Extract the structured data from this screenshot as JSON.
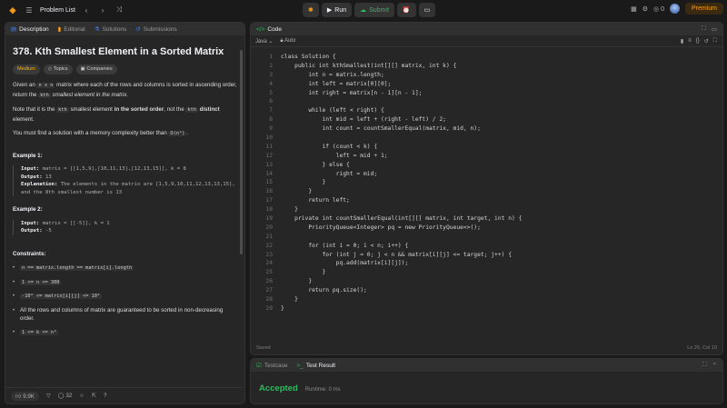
{
  "topbar": {
    "problem_list": "Problem List",
    "run": "Run",
    "submit": "Submit",
    "streak": "0",
    "premium": "Premium"
  },
  "left": {
    "tabs": [
      "Description",
      "Editorial",
      "Solutions",
      "Submissions"
    ],
    "title": "378. Kth Smallest Element in a Sorted Matrix",
    "tags": [
      "Medium",
      "Topics",
      "Companies"
    ],
    "desc1_a": "Given an ",
    "desc1_code1": "n x n",
    "desc1_b": " matrix where each of the rows and columns is sorted in ascending order, return the ",
    "desc1_code2": "kth",
    "desc1_c": " smallest element in the matrix.",
    "desc2_a": "Note that it is the ",
    "desc2_code": "kth",
    "desc2_b": " smallest element ",
    "desc2_bold": "in the sorted order",
    "desc2_c": ", not the ",
    "desc2_code2": "kth",
    "desc2_bold2": " distinct",
    "desc2_d": " element.",
    "desc3_a": "You must find a solution with a memory complexity better than ",
    "desc3_code": "O(n²)",
    "desc3_b": ".",
    "ex1_head": "Example 1:",
    "ex1_input_label": "Input:",
    "ex1_input": " matrix = [[1,5,9],[10,11,13],[12,13,15]], k = 8",
    "ex1_output_label": "Output:",
    "ex1_output": " 13",
    "ex1_expl_label": "Explanation:",
    "ex1_expl": " The elements in the matrix are [1,5,9,10,11,12,13,13,15], and the 8th smallest number is 13",
    "ex2_head": "Example 2:",
    "ex2_input_label": "Input:",
    "ex2_input": " matrix = [[-5]], k = 1",
    "ex2_output_label": "Output:",
    "ex2_output": " -5",
    "cons_head": "Constraints:",
    "cons": [
      "n == matrix.length == matrix[i].length",
      "1 <= n <= 300",
      "-10⁹ <= matrix[i][j] <= 10⁹",
      "All the rows and columns of matrix are guaranteed to be sorted in non-decreasing order.",
      "1 <= k <= n²"
    ],
    "likes": "9.9K",
    "comments": "32"
  },
  "editor": {
    "tab": "Code",
    "lang": "Java",
    "auto": "Auto",
    "lines": [
      "class Solution {",
      "    public int kthSmallest(int[][] matrix, int k) {",
      "        int n = matrix.length;",
      "        int left = matrix[0][0];",
      "        int right = matrix[n - 1][n - 1];",
      "",
      "        while (left < right) {",
      "            int mid = left + (right - left) / 2;",
      "            int count = countSmallerEqual(matrix, mid, n);",
      "",
      "            if (count < k) {",
      "                left = mid + 1;",
      "            } else {",
      "                right = mid;",
      "            }",
      "        }",
      "        return left;",
      "    }",
      "    private int countSmallerEqual(int[][] matrix, int target, int n) {",
      "        PriorityQueue<Integer> pq = new PriorityQueue<>();",
      "",
      "        for (int i = 0; i < n; i++) {",
      "            for (int j = 0; j < n && matrix[i][j] <= target; j++) {",
      "                pq.add(matrix[i][j]);",
      "            }",
      "        }",
      "        return pq.size();",
      "    }",
      "}"
    ],
    "saved": "Saved",
    "position": "Ln 26, Col 10"
  },
  "bottom": {
    "tabs": [
      "Testcase",
      "Test Result"
    ],
    "status": "Accepted",
    "runtime": "Runtime: 0 ms"
  }
}
